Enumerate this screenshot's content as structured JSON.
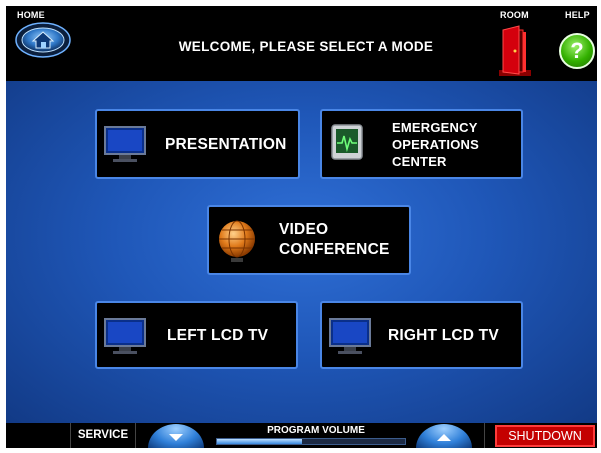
{
  "header": {
    "home_label": "HOME",
    "title": "WELCOME, PLEASE SELECT A MODE",
    "room_label": "ROOM",
    "help_label": "HELP",
    "help_glyph": "?"
  },
  "modes": {
    "presentation": "PRESENTATION",
    "eoc_line1": "EMERGENCY",
    "eoc_line2": "OPERATIONS",
    "eoc_line3": "CENTER",
    "video_line1": "VIDEO",
    "video_line2": "CONFERENCE",
    "left_tv": "LEFT LCD TV",
    "right_tv": "RIGHT LCD TV"
  },
  "footer": {
    "service_label": "SERVICE",
    "volume_label": "PROGRAM VOLUME",
    "volume_level": 0.45,
    "shutdown_label": "SHUTDOWN"
  },
  "icons": {
    "home": "home-icon",
    "room": "door-icon",
    "help": "help-icon",
    "tv": "tv-icon",
    "monitor": "monitor-icon",
    "globe": "globe-icon",
    "volume_down": "chevron-down-icon",
    "volume_up": "chevron-up-icon"
  },
  "colors": {
    "accent_blue": "#2f6fd6",
    "button_border": "#4a86e6",
    "help_green": "#33b000",
    "door_red": "#c4000a",
    "shutdown_red": "#c40000"
  }
}
